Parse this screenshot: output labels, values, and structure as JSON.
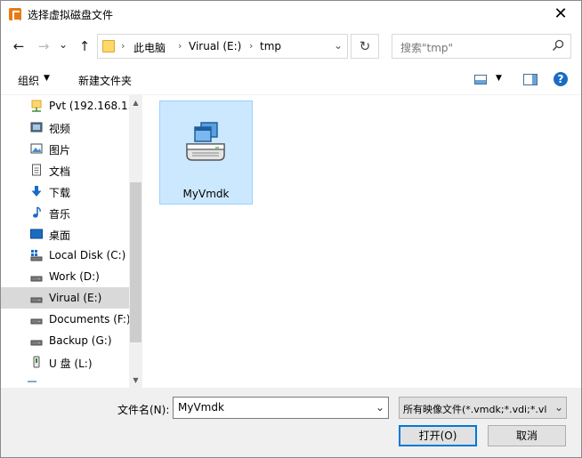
{
  "window": {
    "title": "选择虚拟磁盘文件"
  },
  "nav": {
    "back_glyph": "←",
    "forward_glyph": "→",
    "history_glyph": "⌄",
    "up_glyph": "↑",
    "refresh_glyph": "↻",
    "breadcrumbs": [
      "此电脑",
      "Virual (E:)",
      "tmp"
    ],
    "separator": "›",
    "dropdown_glyph": "⌄"
  },
  "search": {
    "placeholder": "搜索\"tmp\""
  },
  "toolbar": {
    "organize": "组织",
    "new_folder": "新建文件夹",
    "caret": "▼",
    "help": "?"
  },
  "sidebar": {
    "items": [
      {
        "label": "Pvt (192.168.1.1",
        "icon": "network-drive-icon"
      },
      {
        "label": "视频",
        "icon": "video-icon"
      },
      {
        "label": "图片",
        "icon": "picture-icon"
      },
      {
        "label": "文档",
        "icon": "document-icon"
      },
      {
        "label": "下载",
        "icon": "download-icon"
      },
      {
        "label": "音乐",
        "icon": "music-icon"
      },
      {
        "label": "桌面",
        "icon": "desktop-icon"
      },
      {
        "label": "Local Disk (C:)",
        "icon": "system-drive-icon"
      },
      {
        "label": "Work (D:)",
        "icon": "drive-icon"
      },
      {
        "label": "Virual (E:)",
        "icon": "drive-icon",
        "selected": true
      },
      {
        "label": "Documents (F:)",
        "icon": "drive-icon"
      },
      {
        "label": "Backup (G:)",
        "icon": "drive-icon"
      },
      {
        "label": "U 盘 (L:)",
        "icon": "usb-drive-icon"
      }
    ],
    "scroll_up": "▲",
    "scroll_down": "▼"
  },
  "files": [
    {
      "name": "MyVmdk",
      "icon": "virtual-disk-icon",
      "selected": true
    }
  ],
  "footer": {
    "filename_label": "文件名(N):",
    "filename_value": "MyVmdk",
    "filter_value": "所有映像文件(*.vmdk;*.vdi;*.vl",
    "open_label": "打开(O)",
    "cancel_label": "取消",
    "dropdown_glyph": "⌄"
  },
  "colors": {
    "selection_fill": "#cce8ff",
    "selection_border": "#99d1ff",
    "sidebar_selected": "#d9d9d9",
    "primary_button_border": "#0078d7",
    "help_icon": "#1a6bc4",
    "app_icon": "#e87b14"
  }
}
